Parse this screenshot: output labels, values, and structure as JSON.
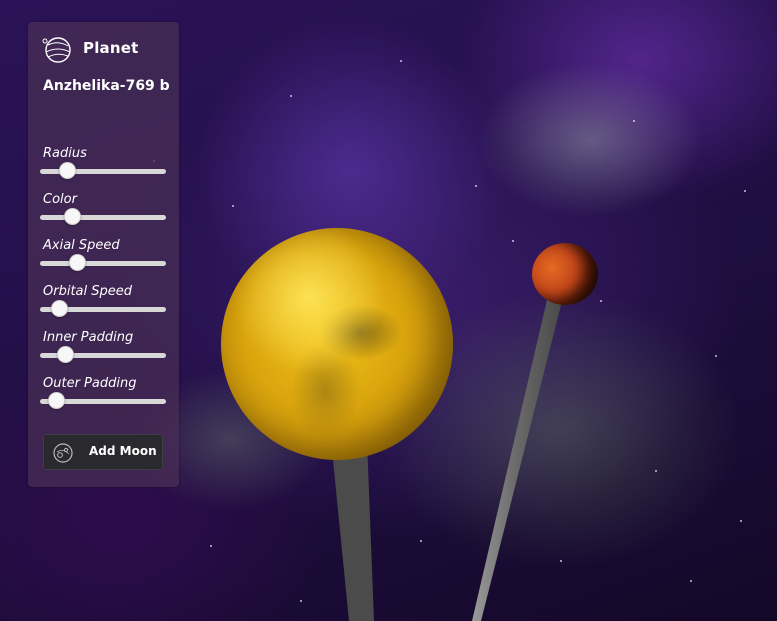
{
  "panel": {
    "title": "Planet",
    "title_icon": "planet-icon",
    "planet_name": "Anzhelika-769 b",
    "controls": [
      {
        "label": "Radius",
        "value": 0.17
      },
      {
        "label": "Color",
        "value": 0.22
      },
      {
        "label": "Axial Speed",
        "value": 0.27
      },
      {
        "label": "Orbital Speed",
        "value": 0.1
      },
      {
        "label": "Inner Padding",
        "value": 0.16
      },
      {
        "label": "Outer Padding",
        "value": 0.07
      }
    ],
    "add_moon": {
      "label": "Add Moon",
      "icon": "moon-orbit-icon"
    }
  },
  "scene": {
    "sun_color": "#d9a40d",
    "planet_color": "#c4471a",
    "pole_color": "#6e6e6e"
  }
}
